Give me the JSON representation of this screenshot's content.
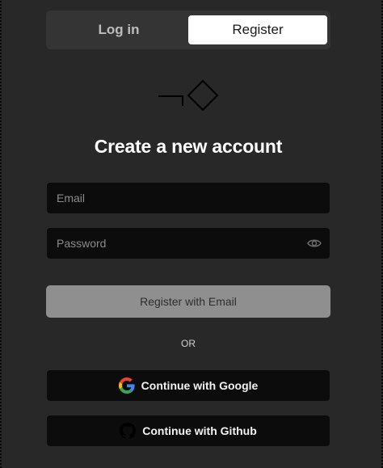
{
  "tabs": {
    "login_label": "Log in",
    "register_label": "Register",
    "active": "register"
  },
  "heading": "Create a new account",
  "form": {
    "email_placeholder": "Email",
    "email_value": "",
    "password_placeholder": "Password",
    "password_value": "",
    "submit_label": "Register with Email"
  },
  "divider_text": "OR",
  "oauth": {
    "google_label": "Continue with Google",
    "github_label": "Continue with Github"
  },
  "icons": {
    "logo": "logo-icon",
    "password_toggle": "eye-icon",
    "google": "google-icon",
    "github": "github-icon"
  },
  "colors": {
    "background": "#282828",
    "tab_active_bg": "#ffffff",
    "input_bg": "#0c0c0c",
    "submit_bg": "#8f8f8f"
  }
}
